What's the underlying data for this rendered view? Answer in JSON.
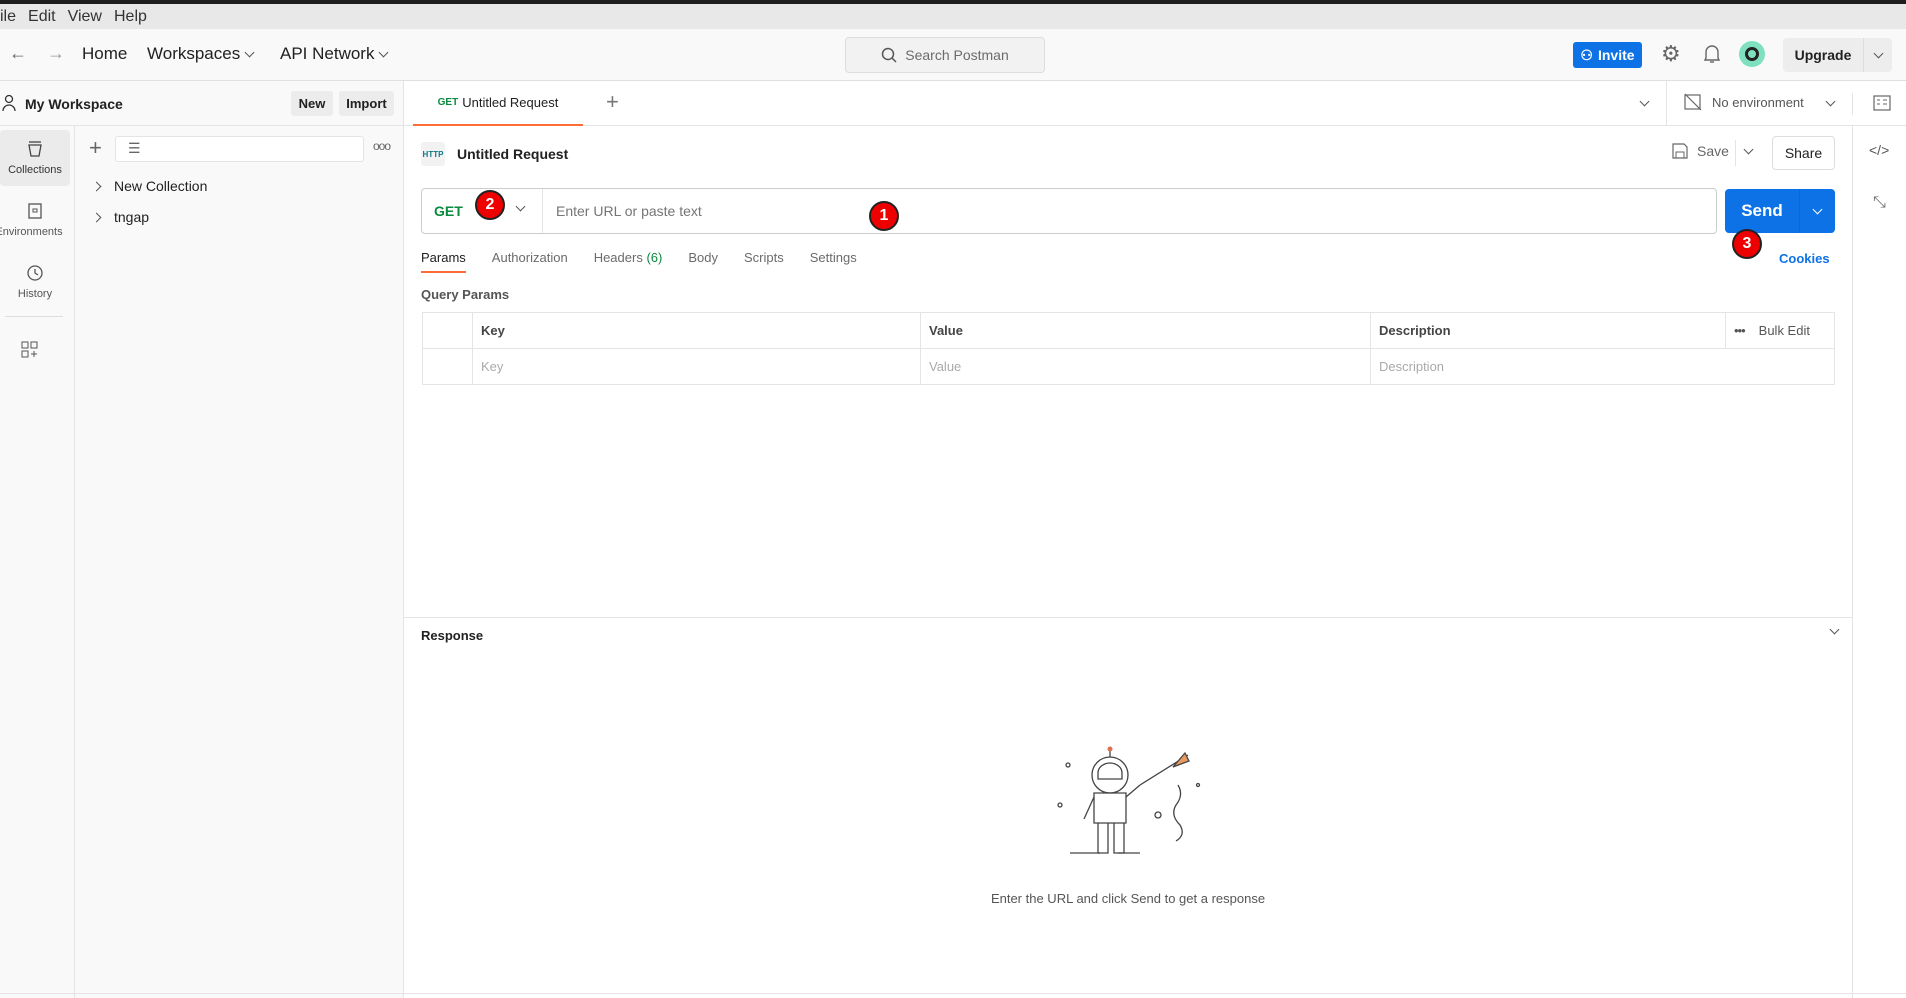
{
  "menu": [
    "ile",
    "Edit",
    "View",
    "Help"
  ],
  "header": {
    "home": "Home",
    "workspaces": "Workspaces",
    "api_network": "API Network",
    "search_placeholder": "Search Postman",
    "invite": "Invite",
    "upgrade": "Upgrade"
  },
  "sidebar": {
    "workspace": "My Workspace",
    "new": "New",
    "import": "Import",
    "rail": [
      {
        "label": "Collections",
        "icon": "collections-icon"
      },
      {
        "label": "Environments",
        "icon": "environments-icon"
      },
      {
        "label": "History",
        "icon": "history-icon"
      }
    ],
    "collections": [
      "New Collection",
      "tngap"
    ]
  },
  "tabs": {
    "active_method": "GET",
    "active_title": "Untitled Request",
    "environment": "No environment"
  },
  "request": {
    "title": "Untitled Request",
    "save": "Save",
    "share": "Share",
    "method": "GET",
    "url_placeholder": "Enter URL or paste text",
    "send": "Send",
    "cookies": "Cookies",
    "subtabs": [
      "Params",
      "Authorization",
      "Headers",
      "Body",
      "Scripts",
      "Settings"
    ],
    "headers_count": "(6)",
    "query_params": "Query Params",
    "columns": [
      "Key",
      "Value",
      "Description"
    ],
    "bulk_edit": "Bulk Edit",
    "placeholders": [
      "Key",
      "Value",
      "Description"
    ]
  },
  "response": {
    "title": "Response",
    "empty_text": "Enter the URL and click Send to get a response"
  },
  "markers": [
    "1",
    "2",
    "3"
  ],
  "colors": {
    "accent": "#0c72e6",
    "get": "#0a8a3f",
    "tab_underline": "#ff6c37",
    "marker": "#ee0000"
  }
}
